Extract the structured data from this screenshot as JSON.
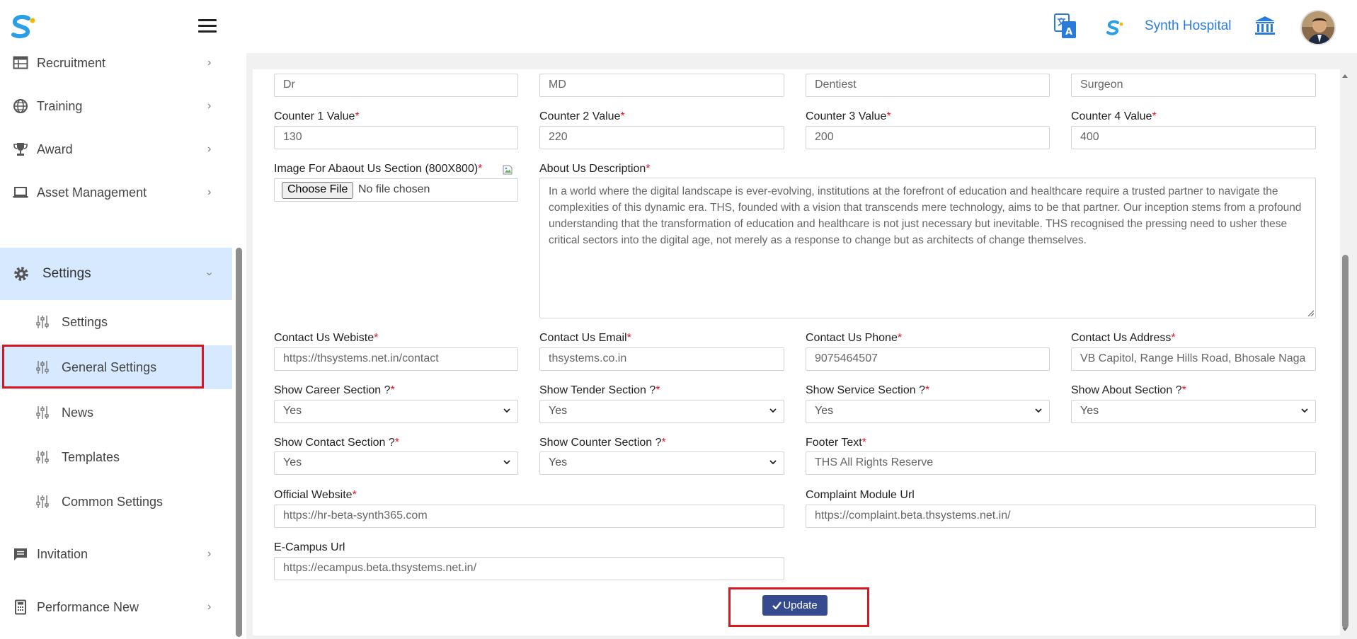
{
  "header": {
    "hospital_name": "Synth Hospital"
  },
  "sidebar": {
    "items": [
      {
        "label": "Recruitment",
        "icon": "table-icon"
      },
      {
        "label": "Training",
        "icon": "globe-icon"
      },
      {
        "label": "Award",
        "icon": "trophy-icon"
      },
      {
        "label": "Asset Management",
        "icon": "laptop-icon"
      },
      {
        "label": "Settings",
        "icon": "gear-icon"
      },
      {
        "label": "Invitation",
        "icon": "message-icon"
      },
      {
        "label": "Performance New",
        "icon": "calculator-icon"
      }
    ],
    "sub_items": [
      {
        "label": "Settings"
      },
      {
        "label": "General Settings"
      },
      {
        "label": "News"
      },
      {
        "label": "Templates"
      },
      {
        "label": "Common Settings"
      }
    ]
  },
  "form": {
    "top_row": [
      "Dr",
      "MD",
      "Dentiest",
      "Surgeon"
    ],
    "counters": [
      {
        "label": "Counter 1 Value",
        "value": "130"
      },
      {
        "label": "Counter 2 Value",
        "value": "220"
      },
      {
        "label": "Counter 3 Value",
        "value": "200"
      },
      {
        "label": "Counter 4 Value",
        "value": "400"
      }
    ],
    "image_label": "Image For Abaout Us Section (800X800)",
    "choose_file": "Choose File",
    "no_file": "No file chosen",
    "about_label": "About Us Description",
    "about_text": "In a world where the digital landscape is ever-evolving, institutions at the forefront of education and healthcare require a trusted partner to navigate the complexities of this dynamic era. THS, founded with a vision that transcends mere technology, aims to be that partner. Our inception stems from a profound understanding that the transformation of education and healthcare is not just necessary but inevitable. THS recognised the pressing need to usher these critical sectors into the digital age, not merely as a response to change but as architects of change themselves.",
    "contacts": [
      {
        "label": "Contact Us Webiste",
        "value": "https://thsystems.net.in/contact"
      },
      {
        "label": "Contact Us Email",
        "value": "thsystems.co.in"
      },
      {
        "label": "Contact Us Phone",
        "value": "9075464507"
      },
      {
        "label": "Contact Us Address",
        "value": "VB Capitol, Range Hills Road, Bhosale Naga"
      }
    ],
    "show_row1": [
      {
        "label": "Show Career Section ?",
        "value": "Yes"
      },
      {
        "label": "Show Tender Section ?",
        "value": "Yes"
      },
      {
        "label": "Show Service Section ?",
        "value": "Yes"
      },
      {
        "label": "Show About Section ?",
        "value": "Yes"
      }
    ],
    "show_row2": [
      {
        "label": "Show Contact Section ?",
        "value": "Yes"
      },
      {
        "label": "Show Counter Section ?",
        "value": "Yes"
      }
    ],
    "footer": {
      "label": "Footer Text",
      "value": "THS All Rights Reserve"
    },
    "official": {
      "label": "Official Website",
      "value": "https://hr-beta-synth365.com"
    },
    "complaint": {
      "label": "Complaint Module Url",
      "value": "https://complaint.beta.thsystems.net.in/"
    },
    "ecampus": {
      "label": "E-Campus Url",
      "value": "https://ecampus.beta.thsystems.net.in/"
    },
    "required_mark": "*",
    "update_label": "Update"
  },
  "colors": {
    "accent": "#2a7bd9",
    "active_bg": "#d6e9ff",
    "button": "#354a8f",
    "highlight": "#d9161f",
    "required": "#e0161f"
  }
}
